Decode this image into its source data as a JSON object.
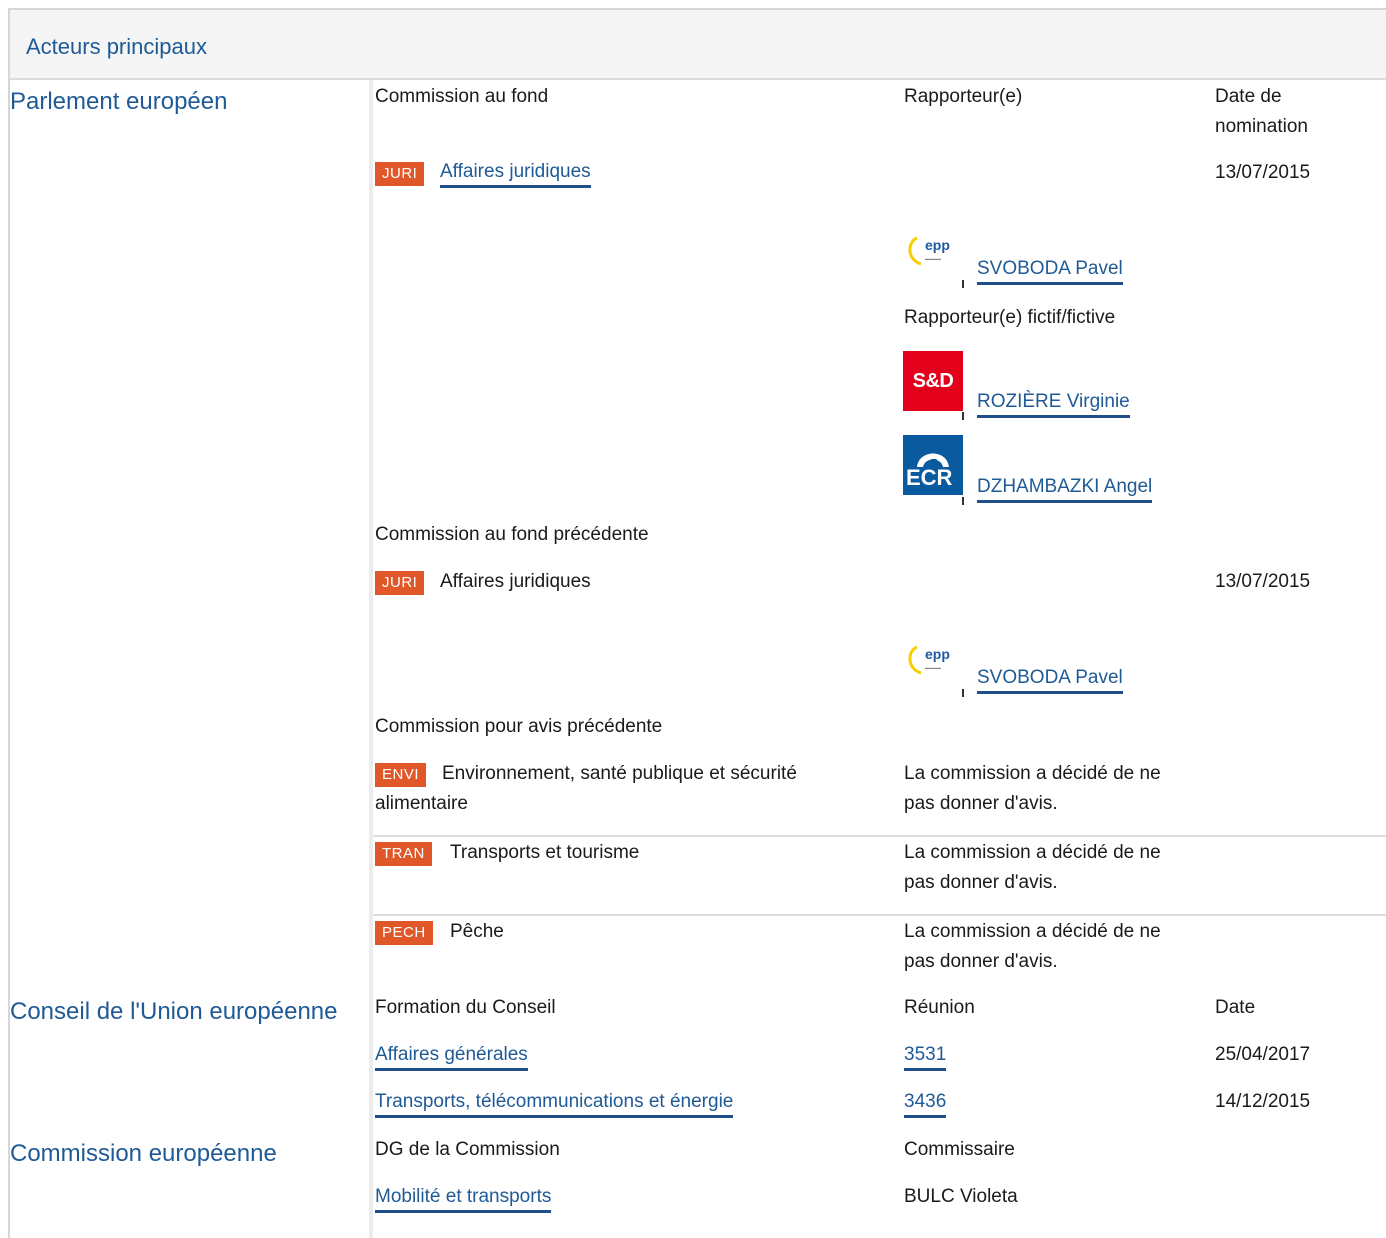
{
  "header": {
    "title": "Acteurs principaux"
  },
  "parliament": {
    "title": "Parlement européen",
    "col_committee": "Commission au fond",
    "col_rapporteur": "Rapporteur(e)",
    "col_date": "Date de nomination",
    "main_committee": {
      "code": "JURI",
      "name": "Affaires juridiques",
      "date": "13/07/2015"
    },
    "rapporteur": {
      "group_logo": "epp-logo",
      "name": "SVOBODA Pavel"
    },
    "shadow_label": "Rapporteur(e) fictif/fictive",
    "shadows": [
      {
        "group_logo": "sd-logo",
        "logo_text": "S&D",
        "name": "ROZIÈRE Virginie"
      },
      {
        "group_logo": "ecr-logo",
        "logo_text": "ECR",
        "name": "DZHAMBAZKI Angel"
      }
    ],
    "prev_committee_label": "Commission au fond précédente",
    "prev_committee": {
      "code": "JURI",
      "name": "Affaires juridiques",
      "date": "13/07/2015"
    },
    "prev_rapporteur": {
      "group_logo": "epp-logo",
      "name": "SVOBODA Pavel"
    },
    "opinion_label": "Commission pour avis précédente",
    "opinions": [
      {
        "code": "ENVI",
        "name_line1": "Environnement, santé publique et sécurité",
        "name_line2": "alimentaire",
        "decision_line1": "La commission a décidé de ne",
        "decision_line2": "pas donner d'avis."
      },
      {
        "code": "TRAN",
        "name_line1": "Transports et tourisme",
        "name_line2": "",
        "decision_line1": "La commission a décidé de ne",
        "decision_line2": "pas donner d'avis."
      },
      {
        "code": "PECH",
        "name_line1": "Pêche",
        "name_line2": "",
        "decision_line1": "La commission a décidé de ne",
        "decision_line2": "pas donner d'avis."
      }
    ]
  },
  "council": {
    "title": "Conseil de l'Union européenne",
    "col_formation": "Formation du Conseil",
    "col_meeting": "Réunion",
    "col_date": "Date",
    "rows": [
      {
        "formation": "Affaires générales",
        "meeting": "3531",
        "date": "25/04/2017"
      },
      {
        "formation": "Transports, télécommunications et énergie",
        "meeting": "3436",
        "date": "14/12/2015"
      }
    ]
  },
  "commission": {
    "title": "Commission européenne",
    "col_dg": "DG de la Commission",
    "col_commissioner": "Commissaire",
    "dg": "Mobilité et transports",
    "commissioner": "BULC Violeta"
  },
  "colors": {
    "link": "#1f5a96",
    "badge": "#e0582a",
    "link_underline": "#1f4e8a"
  }
}
